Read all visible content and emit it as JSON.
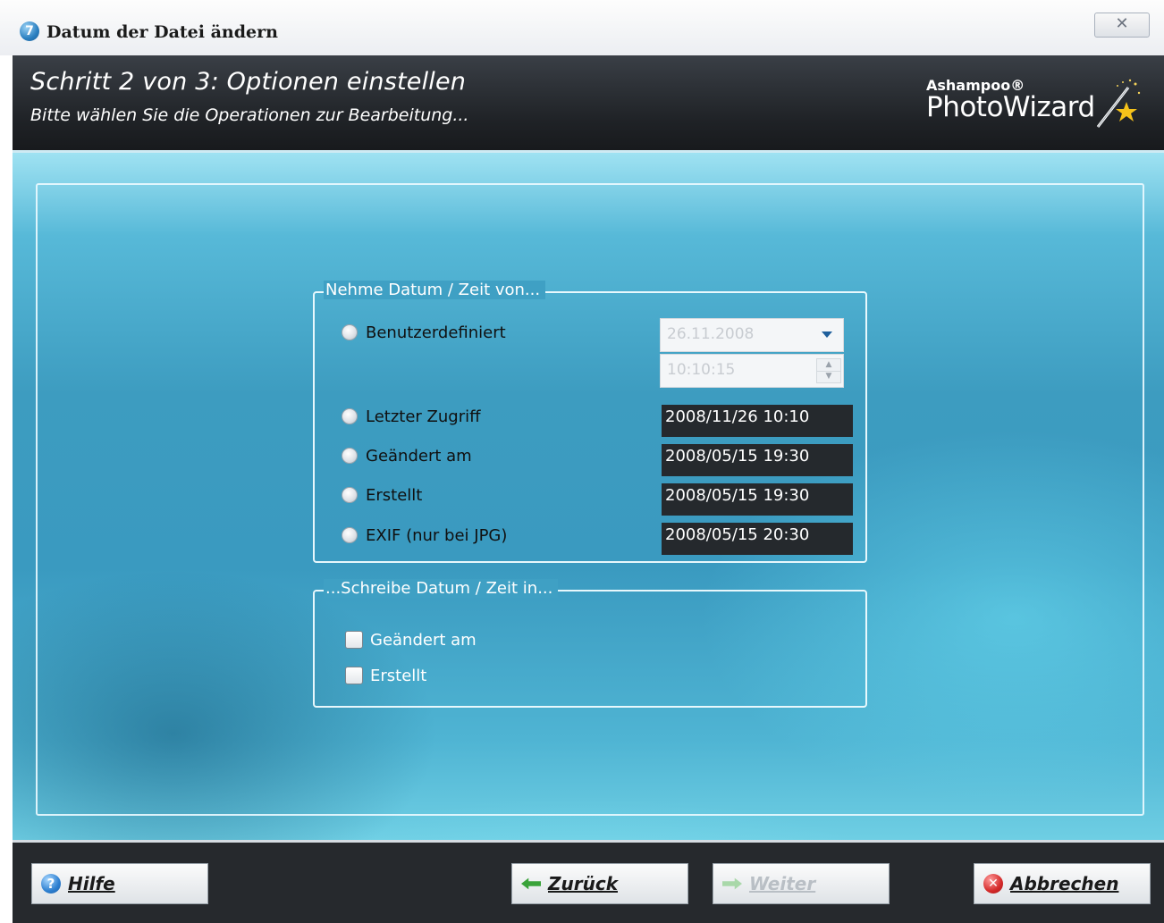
{
  "window": {
    "title": "Datum der Datei ändern",
    "app_icon_glyph": "7",
    "close_glyph": "✕"
  },
  "header": {
    "step_title": "Schritt 2 von 3: Optionen einstellen",
    "step_subtitle": "Bitte wählen Sie die Operationen zur Bearbeitung...",
    "brand_small": "Ashampoo®",
    "brand_big": "PhotoWizard"
  },
  "source_group": {
    "legend": "Nehme Datum / Zeit von...",
    "options": [
      {
        "label": "Benutzerdefiniert",
        "selected": false
      },
      {
        "label": "Letzter Zugriff",
        "selected": false,
        "value": "2008/11/26 10:10"
      },
      {
        "label": "Geändert am",
        "selected": false,
        "value": "2008/05/15 19:30"
      },
      {
        "label": "Erstellt",
        "selected": false,
        "value": "2008/05/15 19:30"
      },
      {
        "label": "EXIF (nur bei JPG)",
        "selected": false,
        "value": "2008/05/15 20:30"
      }
    ],
    "custom_date": "26.11.2008",
    "custom_time": "10:10:15"
  },
  "target_group": {
    "legend": "...Schreibe Datum / Zeit in...",
    "options": [
      {
        "label": "Geändert am",
        "checked": false
      },
      {
        "label": "Erstellt",
        "checked": false
      }
    ]
  },
  "footer": {
    "help_label": "Hilfe",
    "back_label": "Zurück",
    "next_label": "Weiter",
    "cancel_label": "Abbrechen",
    "next_enabled": false
  },
  "colors": {
    "header_bg": "#1f2226",
    "content_accent": "#3d9cc0",
    "footer_bg": "#26292d",
    "value_box_bg": "#25292d"
  },
  "icons": [
    "app-icon",
    "close-icon",
    "magic-wand-icon",
    "dropdown-arrow-icon",
    "spin-up-icon",
    "spin-down-icon",
    "help-icon",
    "back-arrow-icon",
    "next-arrow-icon",
    "cancel-icon"
  ]
}
